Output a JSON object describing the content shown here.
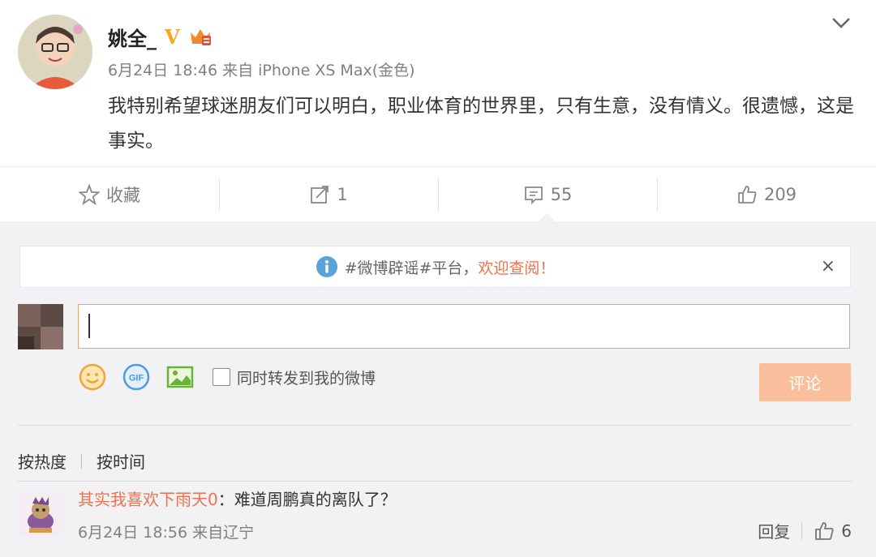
{
  "post": {
    "username": "姚全_",
    "verified_badge": "V",
    "meta": "6月24日 18:46 来自 iPhone XS Max(金色)",
    "text": "我特别希望球迷朋友们可以明白，职业体育的世界里，只有生意，没有情义。很遗憾，这是事实。"
  },
  "actions": {
    "favorite_label": "收藏",
    "repost_count": "1",
    "comment_count": "55",
    "like_count": "209"
  },
  "notice": {
    "text_gray": "#微博辟谣#平台，",
    "text_orange": "欢迎查阅！",
    "close": "×"
  },
  "composer": {
    "input_value": "",
    "sync_label": "同时转发到我的微博",
    "submit_label": "评论"
  },
  "sort": {
    "hot": "按热度",
    "time": "按时间"
  },
  "comments": [
    {
      "author": "其实我喜欢下雨天0",
      "text": "：难道周鹏真的离队了？",
      "meta": "6月24日 18:56 来自辽宁",
      "reply_label": "回复",
      "like_count": "6"
    }
  ],
  "colors": {
    "accent_orange": "#eb7350",
    "verified_gold": "#f5a623",
    "submit_disabled": "#f9bf9d",
    "comment_bg": "#f2f2f5"
  },
  "icons": [
    "chevron-down-icon",
    "star-icon",
    "repost-icon",
    "comment-icon",
    "like-icon",
    "info-icon",
    "emoji-icon",
    "gif-icon",
    "image-icon",
    "crown-icon"
  ]
}
